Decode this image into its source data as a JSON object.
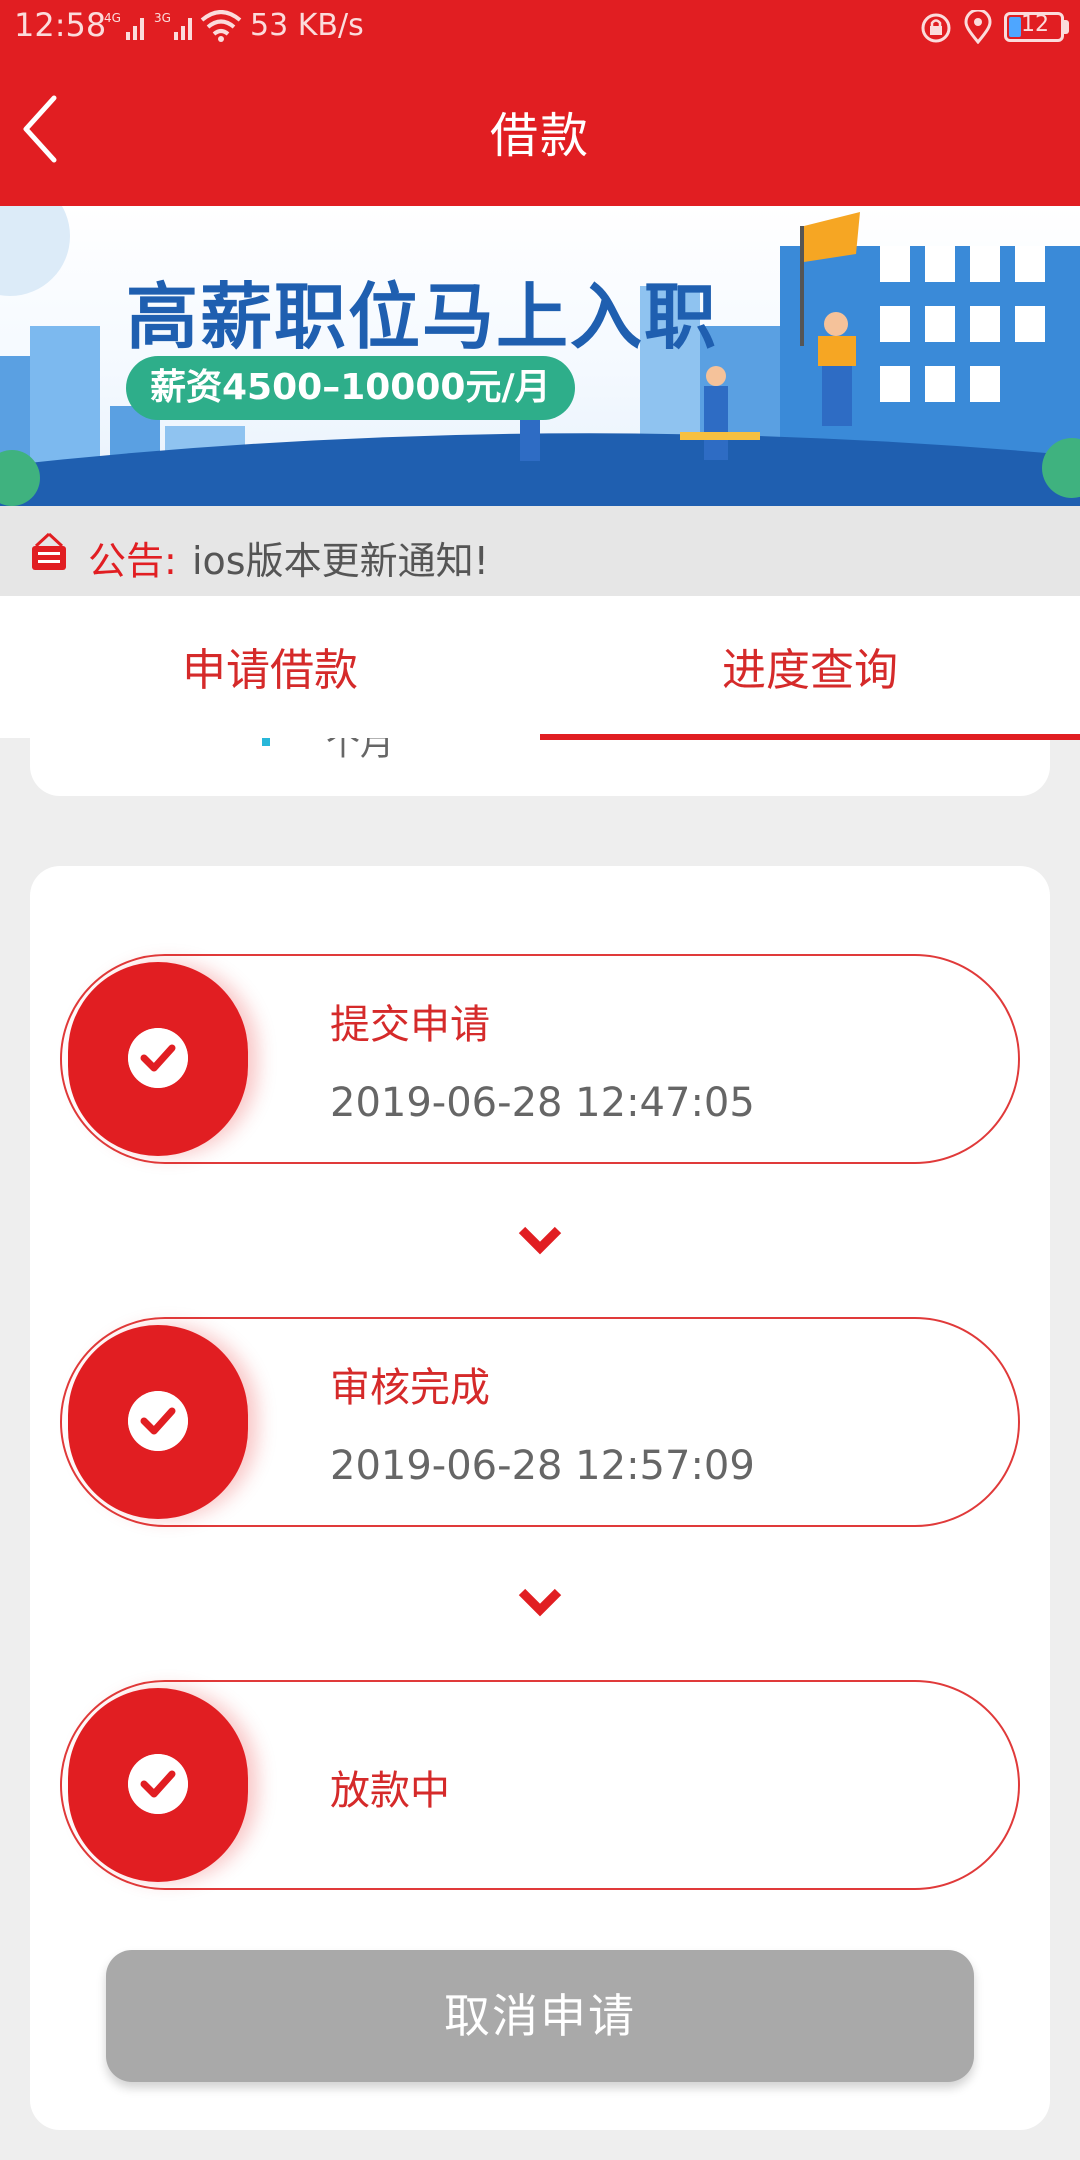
{
  "status_bar": {
    "time": "12:58",
    "signal_1": "4G",
    "signal_2": "3G",
    "network_speed": "53 KB/s",
    "battery_level": "12"
  },
  "header": {
    "title": "借款",
    "back_icon": "chevron-left-icon"
  },
  "banner": {
    "headline": "高薪职位马上入职",
    "salary_pill": "薪资4500–10000元/月"
  },
  "notice": {
    "label": "公告:",
    "text": "ios版本更新通知!"
  },
  "tabs": [
    {
      "label": "申请借款",
      "selected": false
    },
    {
      "label": "进度查询",
      "selected": true
    }
  ],
  "partial_card": {
    "text": "个月"
  },
  "progress_steps": [
    {
      "title": "提交申请",
      "time": "2019-06-28 12:47:05"
    },
    {
      "title": "审核完成",
      "time": "2019-06-28 12:57:09"
    },
    {
      "title": "放款中",
      "time": ""
    }
  ],
  "cancel_button": {
    "label": "取消申请"
  },
  "colors": {
    "primary_red": "#e11e22",
    "disabled_gray": "#a9a9a9",
    "background": "#eeeeee"
  }
}
